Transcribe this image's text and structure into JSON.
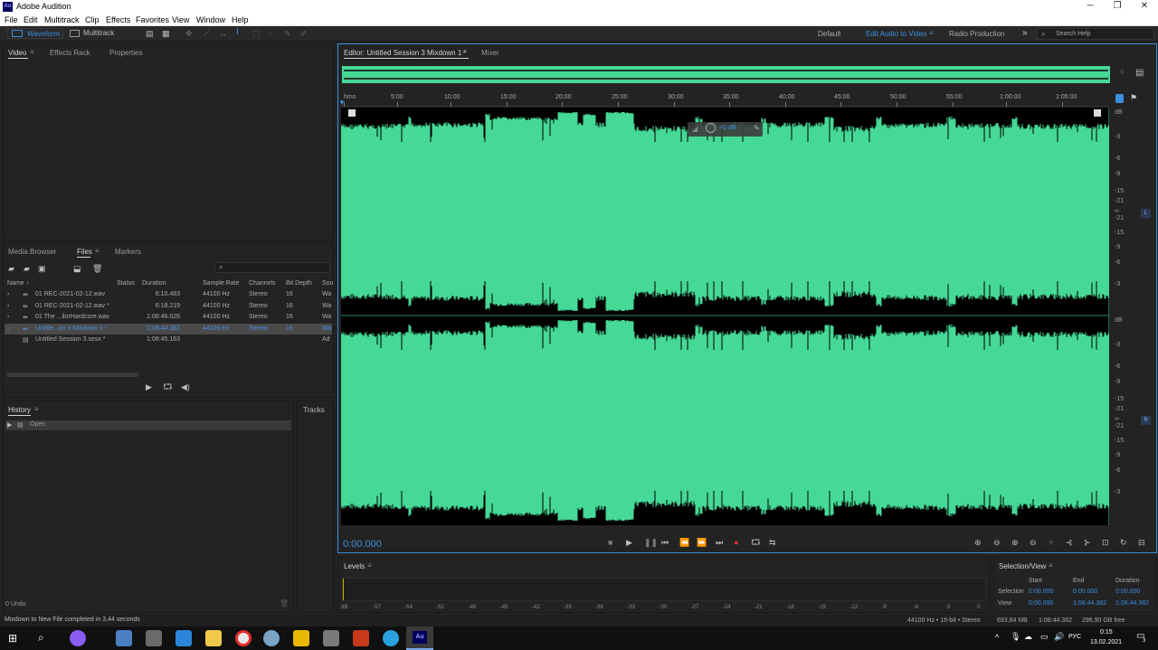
{
  "app": {
    "title": "Adobe Audition",
    "logo": "Au"
  },
  "menu": [
    "File",
    "Edit",
    "Multitrack",
    "Clip",
    "Effects",
    "Favorites",
    "View",
    "Window",
    "Help"
  ],
  "toolbar": {
    "waveform_label": "Waveform",
    "multitrack_label": "Multitrack",
    "workspaces": [
      "Default",
      "Edit Audio to Video",
      "Radio Production"
    ],
    "search_placeholder": "Search Help"
  },
  "top_left_panel": {
    "tabs": [
      "Video",
      "Effects Rack",
      "Properties"
    ]
  },
  "files_panel": {
    "tabs": [
      "Media Browser",
      "Files",
      "Markers"
    ],
    "columns": [
      "Name",
      "Status",
      "Duration",
      "Sample Rate",
      "Channels",
      "Bit Depth",
      "Sou"
    ],
    "rows": [
      {
        "name": "01 REC-2021-02-12.wav",
        "duration": "6:10.483",
        "rate": "44100 Hz",
        "channels": "Stereo",
        "depth": "16",
        "src": "Wa"
      },
      {
        "name": "01 REC-2021-02-12.wav *",
        "duration": "6:18.219",
        "rate": "44100 Hz",
        "channels": "Stereo",
        "depth": "16",
        "src": "Wa"
      },
      {
        "name": "01 The ...llorHardcore.wav",
        "duration": "1:08:46.026",
        "rate": "44100 Hz",
        "channels": "Stereo",
        "depth": "16",
        "src": "Wa"
      },
      {
        "name": "Untitle...on 3 Mixdown 1 *",
        "duration": "1:08:44.382",
        "rate": "44100 Hz",
        "channels": "Stereo",
        "depth": "16",
        "src": "Wa"
      },
      {
        "name": "Untitled Session 3.sesx *",
        "duration": "1:08:45.163",
        "rate": "",
        "channels": "",
        "depth": "",
        "src": "Ad"
      }
    ]
  },
  "history_panel": {
    "tabs": [
      "History",
      "Tracks"
    ],
    "items": [
      "Open"
    ],
    "undo_count": "0 Undo"
  },
  "editor": {
    "tabs": [
      "Editor: Untitled Session 3 Mixdown 1 *",
      "Mixer"
    ],
    "ruler": [
      "hms",
      "5:00",
      "10:00",
      "15:00",
      "20:00",
      "25:00",
      "30:00",
      "35:00",
      "40:00",
      "45:00",
      "50:00",
      "55:00",
      "1:00:00",
      "1:05:00"
    ],
    "db_scale_top": [
      "dB",
      "-3",
      "-6",
      "-9",
      "-15",
      "-21",
      "∞",
      "-21",
      "-15",
      "-9",
      "-6",
      "-3"
    ],
    "db_scale_bottom": [
      "dB",
      "-3",
      "-6",
      "-9",
      "-15",
      "-21",
      "∞",
      "-21",
      "-15",
      "-9",
      "-6",
      "-3"
    ],
    "channel_left": "L",
    "channel_right": "R",
    "hud_gain": "+0 dB",
    "time": "0:00.000",
    "wave_color": "#46d896"
  },
  "levels_panel": {
    "title": "Levels",
    "scale": [
      "dB",
      "-57",
      "-54",
      "-51",
      "-48",
      "-45",
      "-42",
      "-39",
      "-36",
      "-33",
      "-30",
      "-27",
      "-24",
      "-21",
      "-18",
      "-15",
      "-12",
      "-9",
      "-6",
      "-3",
      "0"
    ]
  },
  "selection_panel": {
    "title": "Selection/View",
    "headers": [
      "Start",
      "End",
      "Duration"
    ],
    "selection": {
      "label": "Selection",
      "start": "0:00.000",
      "end": "0:00.000",
      "duration": "0:00.000"
    },
    "view": {
      "label": "View",
      "start": "0:00.000",
      "end": "1:08:44.382",
      "duration": "1:08:44.382"
    }
  },
  "statusbar": {
    "message": "Mixdown to New File completed in 3,44 seconds",
    "format": "44100 Hz • 16-bit • Stereo",
    "size": "693,84 MB",
    "duration": "1:08:44.382",
    "free": "296,90 GB free"
  },
  "taskbar": {
    "lang": "РУС",
    "time": "0:15",
    "date": "13.02.2021",
    "notif": "3"
  }
}
